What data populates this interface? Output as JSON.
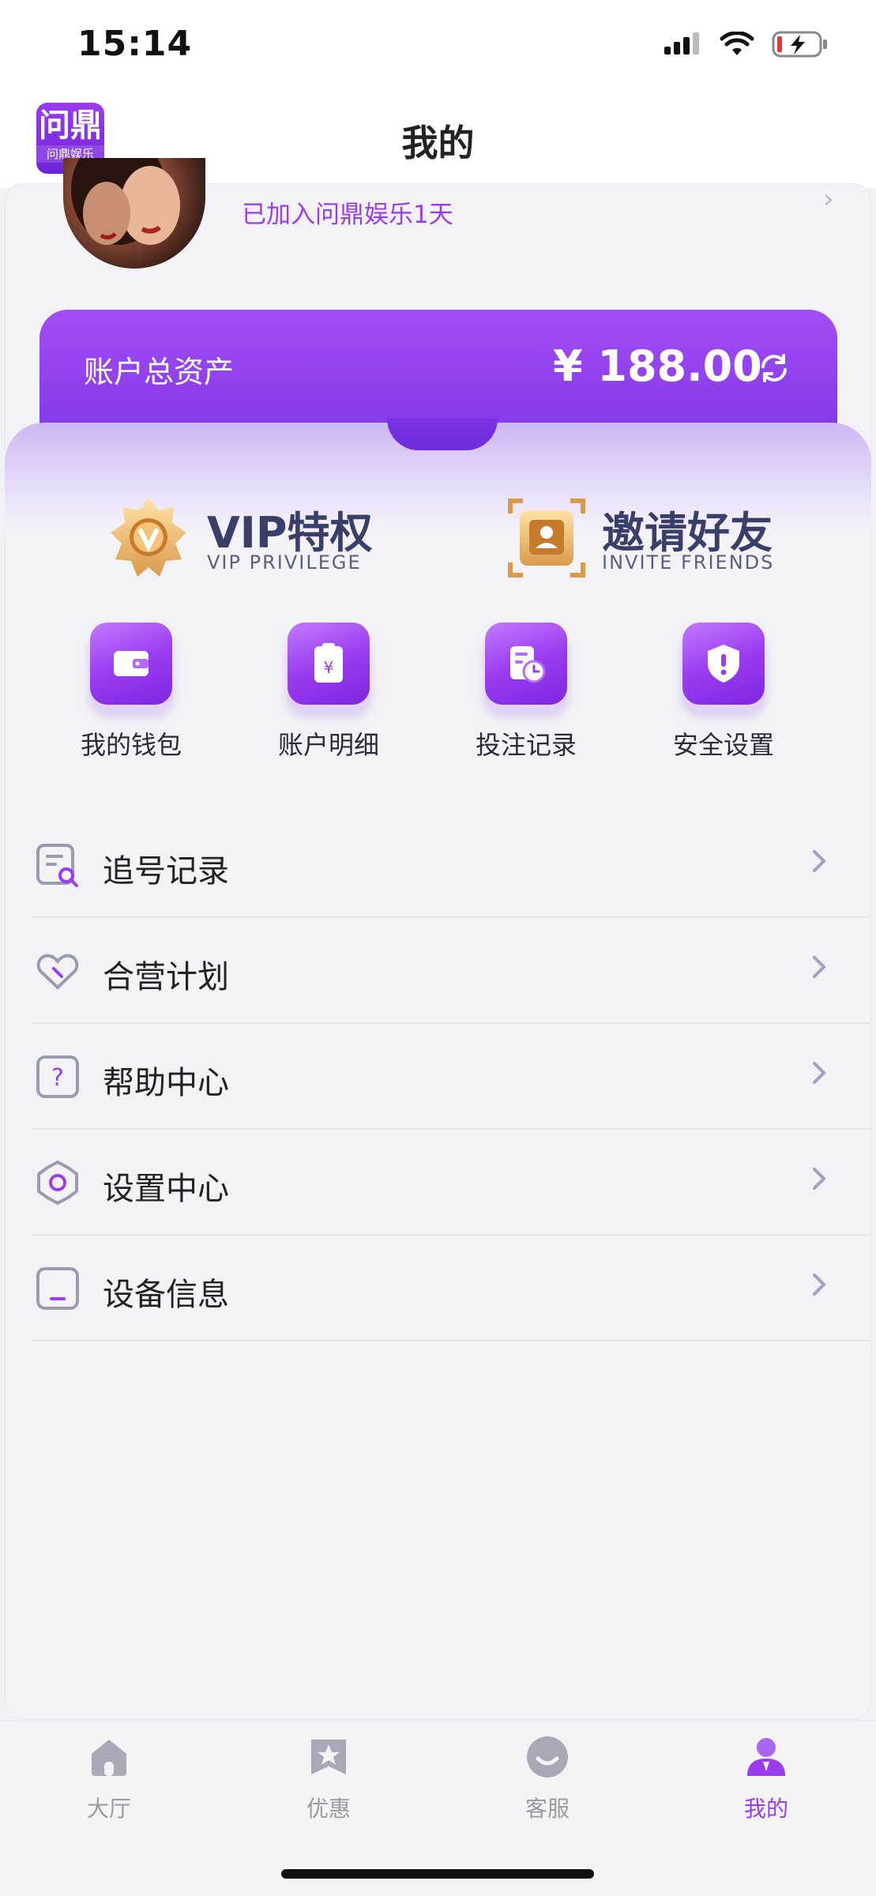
{
  "status_bar": {
    "time": "15:14"
  },
  "header": {
    "title": "我的",
    "logo_main": "问鼎",
    "logo_sub": "问鼎娱乐"
  },
  "profile": {
    "joined_text": "已加入问鼎娱乐1天"
  },
  "assets": {
    "label": "账户总资产",
    "value": "¥ 188.00"
  },
  "privileges": {
    "vip": {
      "title": "VIP特权",
      "subtitle": "VIP PRIVILEGE"
    },
    "invite": {
      "title": "邀请好友",
      "subtitle": "INVITE FRIENDS"
    }
  },
  "quick_actions": [
    {
      "label": "我的钱包",
      "icon": "wallet-icon"
    },
    {
      "label": "账户明细",
      "icon": "bill-icon"
    },
    {
      "label": "投注记录",
      "icon": "bet-record-icon"
    },
    {
      "label": "安全设置",
      "icon": "shield-icon"
    }
  ],
  "menu": [
    {
      "label": "追号记录",
      "icon": "search-record-icon"
    },
    {
      "label": "合营计划",
      "icon": "handshake-icon"
    },
    {
      "label": "帮助中心",
      "icon": "help-icon"
    },
    {
      "label": "设置中心",
      "icon": "gear-icon"
    },
    {
      "label": "设备信息",
      "icon": "device-icon"
    }
  ],
  "tabs": [
    {
      "label": "大厅",
      "icon": "home-icon",
      "active": false
    },
    {
      "label": "优惠",
      "icon": "star-bookmark-icon",
      "active": false
    },
    {
      "label": "客服",
      "icon": "smile-icon",
      "active": false
    },
    {
      "label": "我的",
      "icon": "user-icon",
      "active": true
    }
  ],
  "colors": {
    "accent": "#9a3cf0",
    "banner_top": "#a24df5",
    "banner_bottom": "#7b32e4",
    "text_dark": "#3a3f6a"
  }
}
